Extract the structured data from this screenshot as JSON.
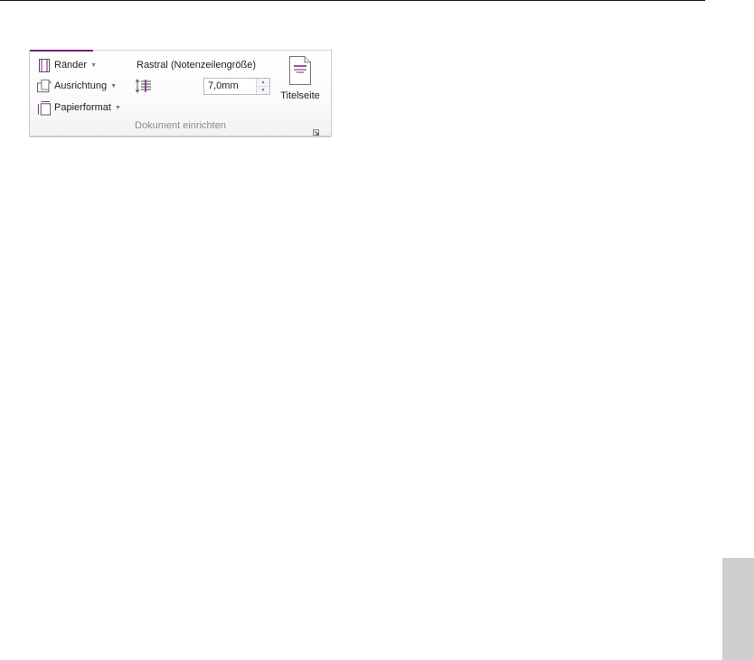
{
  "ribbon_group": {
    "margins_label": "Ränder",
    "orientation_label": "Ausrichtung",
    "paper_format_label": "Papierformat",
    "rastral_label": "Rastral (Notenzeilengröße)",
    "rastral_value": "7,0mm",
    "title_page_label": "Titelseite",
    "group_label": "Dokument einrichten"
  },
  "colors": {
    "accent": "#7b1e7a",
    "side_tab": "#cfcfcf"
  },
  "icons": {
    "margins": "margins-icon",
    "orientation": "orientation-icon",
    "paper_format": "paper-format-icon",
    "staff_size": "staff-size-icon",
    "title_page": "title-page-icon",
    "dialog_launcher": "dialog-launcher-icon"
  }
}
